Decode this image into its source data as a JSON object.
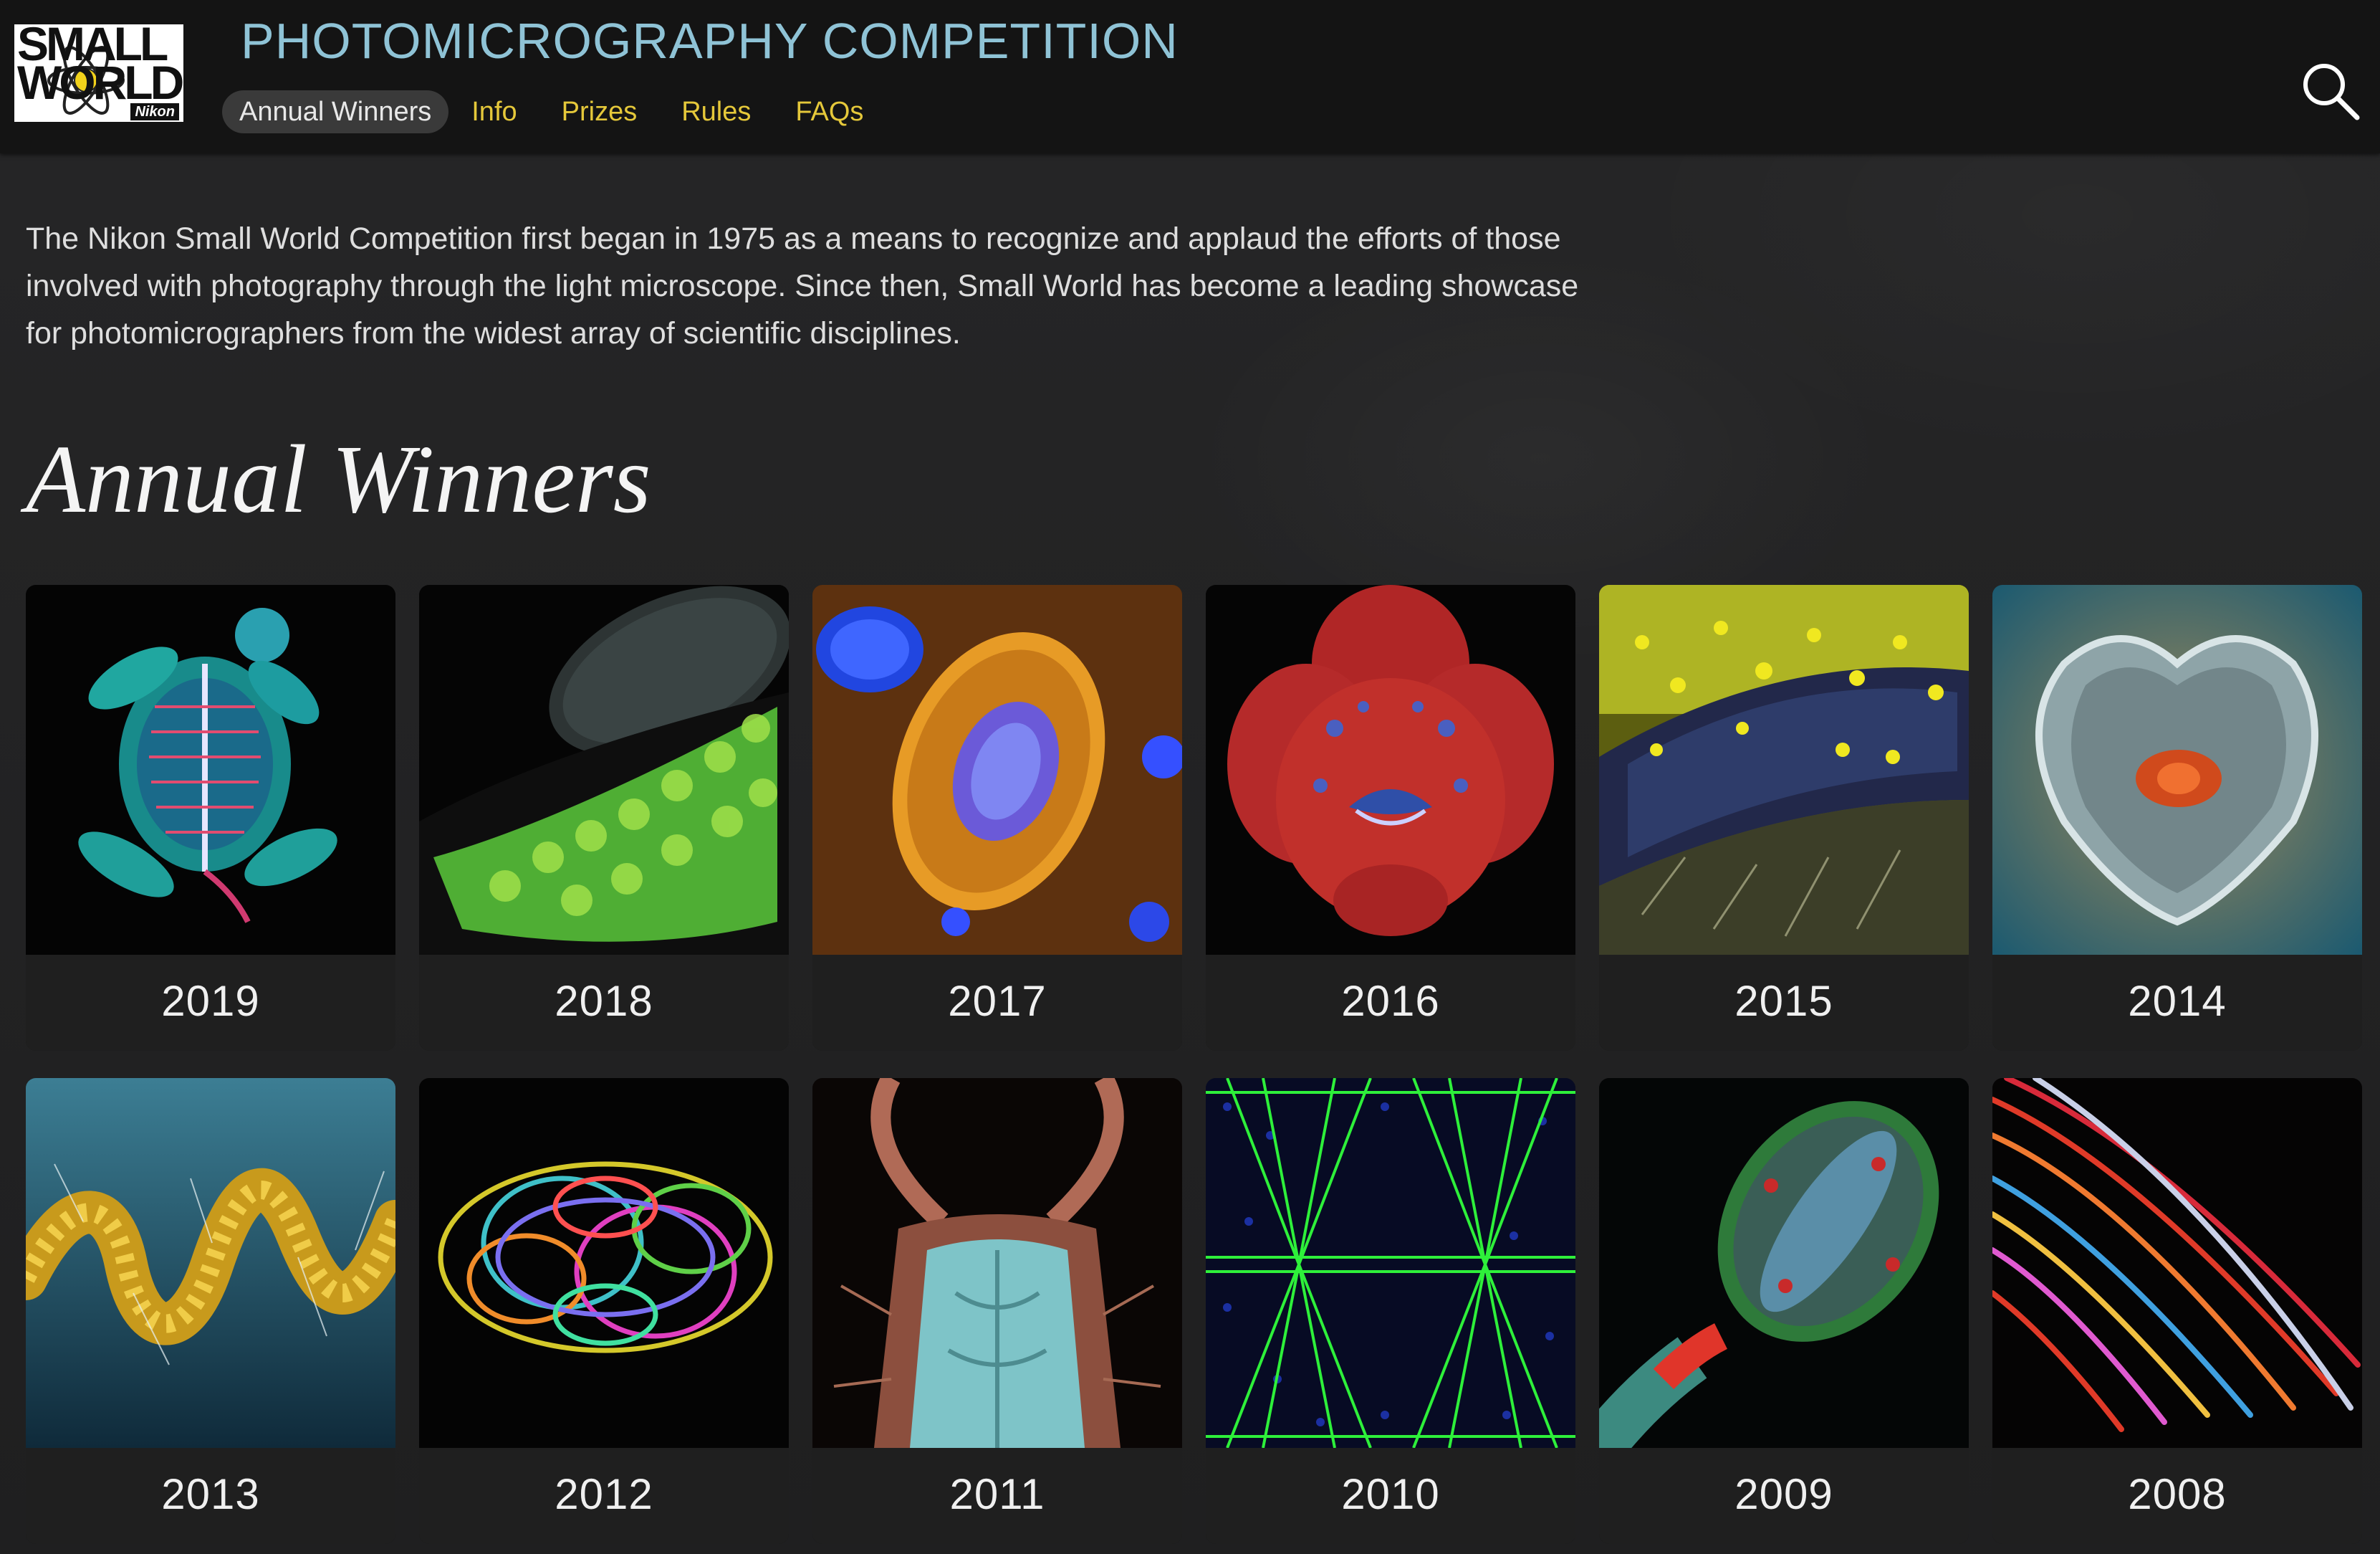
{
  "header": {
    "logo": {
      "line1": "SMALL",
      "line2": "WORLD",
      "brand": "Nikon"
    },
    "site_title": "PHOTOMICROGRAPHY COMPETITION",
    "nav": [
      {
        "label": "Annual Winners",
        "active": true
      },
      {
        "label": "Info",
        "active": false
      },
      {
        "label": "Prizes",
        "active": false
      },
      {
        "label": "Rules",
        "active": false
      },
      {
        "label": "FAQs",
        "active": false
      }
    ],
    "search_icon": "search-icon"
  },
  "intro": "The Nikon Small World Competition first began in 1975 as a means to recognize and applaud the efforts of those involved with photography through the light microscope. Since then, Small World has become a leading showcase for photomicrographers from the widest array of scientific disciplines.",
  "section_title": "Annual Winners",
  "winners": [
    {
      "year": "2019",
      "subject": "turtle-embryo"
    },
    {
      "year": "2018",
      "subject": "butterfly-eye-scales"
    },
    {
      "year": "2017",
      "subject": "cell-cytoskeleton"
    },
    {
      "year": "2016",
      "subject": "frog-embryo-face"
    },
    {
      "year": "2015",
      "subject": "bee-eye-pollen"
    },
    {
      "year": "2014",
      "subject": "rotifer"
    },
    {
      "year": "2013",
      "subject": "spiral-diatom-chain"
    },
    {
      "year": "2012",
      "subject": "bug-nervous-tissue"
    },
    {
      "year": "2011",
      "subject": "insect-mouthparts"
    },
    {
      "year": "2010",
      "subject": "muscle-fibers"
    },
    {
      "year": "2009",
      "subject": "plant-ovary"
    },
    {
      "year": "2008",
      "subject": "colored-fibers"
    }
  ],
  "colors": {
    "title_blue": "#8fc3d6",
    "nav_yellow": "#e5c83a",
    "header_bg": "#141414",
    "page_bg": "#232324"
  }
}
